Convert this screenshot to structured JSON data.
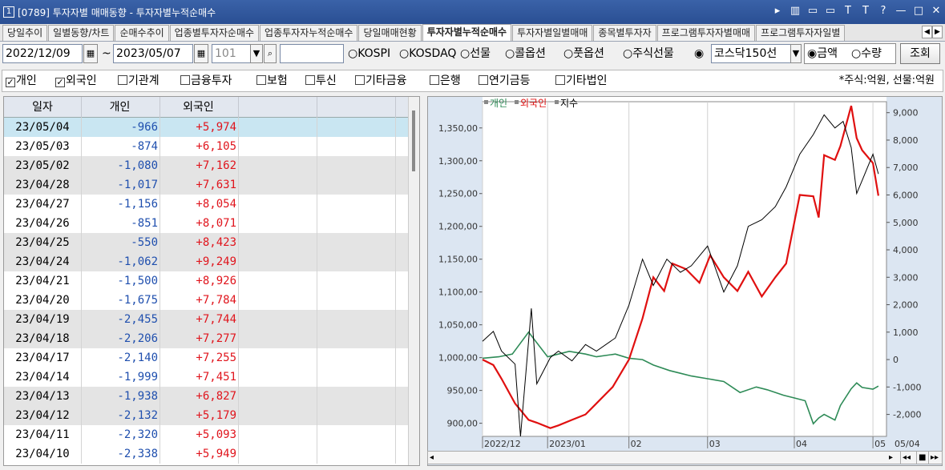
{
  "window": {
    "number": "1",
    "title": "[0789] 투자자별 매매동향 - 투자자별누적순매수",
    "controls": [
      "▸",
      "▥",
      "▭",
      "▭",
      "T",
      "T",
      "?",
      "—",
      "□",
      "✕"
    ]
  },
  "tabs": [
    {
      "label": "당일추이",
      "active": false
    },
    {
      "label": "일별동향/차트",
      "active": false
    },
    {
      "label": "순매수추이",
      "active": false
    },
    {
      "label": "업종별투자자순매수",
      "active": false
    },
    {
      "label": "업종투자자누적순매수",
      "active": false
    },
    {
      "label": "당일매매현황",
      "active": false
    },
    {
      "label": "투자자별누적순매수",
      "active": true
    },
    {
      "label": "투자자별일별매매",
      "active": false
    },
    {
      "label": "종목별투자자",
      "active": false
    },
    {
      "label": "프로그램투자자별매매",
      "active": false
    },
    {
      "label": "프로그램투자자일별",
      "active": false
    }
  ],
  "controls": {
    "start_date": "2022/12/09",
    "tilde": "~",
    "end_date": "2023/05/07",
    "code": "101",
    "code_name": "",
    "market_radios": [
      {
        "label": "KOSPI",
        "checked": false
      },
      {
        "label": "KOSDAQ",
        "checked": false
      },
      {
        "label": "선물",
        "checked": false
      },
      {
        "label": "콜옵션",
        "checked": false
      },
      {
        "label": "풋옵션",
        "checked": false
      },
      {
        "label": "주식선물",
        "checked": false
      },
      {
        "label": "",
        "checked": true
      }
    ],
    "index_select": "코스닥150선",
    "unit_radios": [
      {
        "label": "금액",
        "checked": true
      },
      {
        "label": "수량",
        "checked": false
      }
    ],
    "search_label": "조회"
  },
  "filters": [
    {
      "label": "개인",
      "checked": true
    },
    {
      "label": "외국인",
      "checked": true
    },
    {
      "label": "기관계",
      "checked": false
    },
    {
      "label": "금융투자",
      "checked": false
    },
    {
      "label": "보험",
      "checked": false
    },
    {
      "label": "투신",
      "checked": false
    },
    {
      "label": "기타금융",
      "checked": false
    },
    {
      "label": "은행",
      "checked": false
    },
    {
      "label": "연기금등",
      "checked": false
    },
    {
      "label": "기타법인",
      "checked": false
    }
  ],
  "unit_note": "*주식:억원, 선물:억원",
  "table": {
    "columns": [
      "일자",
      "개인",
      "외국인"
    ],
    "rows": [
      {
        "date": "23/05/04",
        "individual": "-966",
        "foreign": "+5,974"
      },
      {
        "date": "23/05/03",
        "individual": "-874",
        "foreign": "+6,105"
      },
      {
        "date": "23/05/02",
        "individual": "-1,080",
        "foreign": "+7,162"
      },
      {
        "date": "23/04/28",
        "individual": "-1,017",
        "foreign": "+7,631"
      },
      {
        "date": "23/04/27",
        "individual": "-1,156",
        "foreign": "+8,054"
      },
      {
        "date": "23/04/26",
        "individual": "-851",
        "foreign": "+8,071"
      },
      {
        "date": "23/04/25",
        "individual": "-550",
        "foreign": "+8,423"
      },
      {
        "date": "23/04/24",
        "individual": "-1,062",
        "foreign": "+9,249"
      },
      {
        "date": "23/04/21",
        "individual": "-1,500",
        "foreign": "+8,926"
      },
      {
        "date": "23/04/20",
        "individual": "-1,675",
        "foreign": "+7,784"
      },
      {
        "date": "23/04/19",
        "individual": "-2,455",
        "foreign": "+7,744"
      },
      {
        "date": "23/04/18",
        "individual": "-2,206",
        "foreign": "+7,277"
      },
      {
        "date": "23/04/17",
        "individual": "-2,140",
        "foreign": "+7,255"
      },
      {
        "date": "23/04/14",
        "individual": "-1,999",
        "foreign": "+7,451"
      },
      {
        "date": "23/04/13",
        "individual": "-1,938",
        "foreign": "+6,827"
      },
      {
        "date": "23/04/12",
        "individual": "-2,132",
        "foreign": "+5,179"
      },
      {
        "date": "23/04/11",
        "individual": "-2,320",
        "foreign": "+5,093"
      },
      {
        "date": "23/04/10",
        "individual": "-2,338",
        "foreign": "+5,949"
      }
    ]
  },
  "chart_data": {
    "type": "line",
    "legend": [
      "개인",
      "외국인",
      "지수"
    ],
    "colors": {
      "개인": "#2e8b57",
      "외국인": "#e01010",
      "지수": "#000000"
    },
    "left_axis": {
      "ticks": [
        "1,350,00",
        "1,300,00",
        "1,250,00",
        "1,200,00",
        "1,150,00",
        "1,100,00",
        "1,050,00",
        "1,000,00",
        "950,00",
        "900,00"
      ],
      "ylim": [
        880,
        1390
      ]
    },
    "right_axis": {
      "ticks": [
        "9,000",
        "8,000",
        "7,000",
        "6,000",
        "5,000",
        "4,000",
        "3,000",
        "2,000",
        "1,000",
        "0",
        "-1,000",
        "-2,000"
      ],
      "ylim": [
        -2800,
        9400
      ]
    },
    "x_ticks": [
      "2022/12",
      "2023/01",
      "02",
      "03",
      "04",
      "05",
      "05/04"
    ],
    "x_tick_dates": [
      "2022-12-09",
      "2023-01-02",
      "2023-02-01",
      "2023-03-02",
      "2023-04-03",
      "2023-05-02"
    ],
    "x_range": [
      "2022-12-09",
      "2023-05-07"
    ],
    "series": [
      {
        "name": "개인",
        "axis": "right",
        "dates": [
          "2022-12-09",
          "2022-12-15",
          "2022-12-20",
          "2022-12-26",
          "2023-01-02",
          "2023-01-06",
          "2023-01-10",
          "2023-01-16",
          "2023-01-20",
          "2023-01-27",
          "2023-02-01",
          "2023-02-06",
          "2023-02-10",
          "2023-02-16",
          "2023-02-20",
          "2023-02-24",
          "2023-03-02",
          "2023-03-08",
          "2023-03-14",
          "2023-03-20",
          "2023-03-24",
          "2023-03-30",
          "2023-04-03",
          "2023-04-07",
          "2023-04-10",
          "2023-04-12",
          "2023-04-14",
          "2023-04-18",
          "2023-04-20",
          "2023-04-24",
          "2023-04-26",
          "2023-04-28",
          "2023-05-02",
          "2023-05-04"
        ],
        "values": [
          50,
          100,
          200,
          1000,
          100,
          200,
          300,
          200,
          100,
          200,
          50,
          0,
          -200,
          -400,
          -500,
          -600,
          -700,
          -800,
          -1200,
          -1000,
          -1100,
          -1300,
          -1400,
          -1500,
          -2338,
          -2132,
          -1999,
          -2206,
          -1675,
          -1062,
          -851,
          -1017,
          -1080,
          -966
        ]
      },
      {
        "name": "외국인",
        "axis": "right",
        "dates": [
          "2022-12-09",
          "2022-12-13",
          "2022-12-16",
          "2022-12-21",
          "2022-12-26",
          "2022-12-29",
          "2023-01-03",
          "2023-01-06",
          "2023-01-11",
          "2023-01-16",
          "2023-01-19",
          "2023-01-26",
          "2023-02-01",
          "2023-02-06",
          "2023-02-10",
          "2023-02-14",
          "2023-02-17",
          "2023-02-22",
          "2023-02-27",
          "2023-03-03",
          "2023-03-08",
          "2023-03-13",
          "2023-03-17",
          "2023-03-22",
          "2023-03-27",
          "2023-03-31",
          "2023-04-05",
          "2023-04-10",
          "2023-04-12",
          "2023-04-14",
          "2023-04-18",
          "2023-04-20",
          "2023-04-24",
          "2023-04-26",
          "2023-04-28",
          "2023-05-02",
          "2023-05-04"
        ],
        "values": [
          0,
          -200,
          -700,
          -1600,
          -2200,
          -2300,
          -2500,
          -2400,
          -2200,
          -2000,
          -1700,
          -1000,
          0,
          1500,
          3000,
          2500,
          3500,
          3300,
          2800,
          3800,
          3000,
          2500,
          3200,
          2300,
          3000,
          3500,
          6000,
          5949,
          5179,
          7451,
          7277,
          7784,
          9249,
          8071,
          7631,
          7162,
          5974
        ]
      },
      {
        "name": "지수",
        "axis": "left",
        "dates": [
          "2022-12-09",
          "2022-12-13",
          "2022-12-16",
          "2022-12-21",
          "2022-12-23",
          "2022-12-27",
          "2022-12-29",
          "2023-01-03",
          "2023-01-06",
          "2023-01-11",
          "2023-01-16",
          "2023-01-20",
          "2023-01-27",
          "2023-02-01",
          "2023-02-06",
          "2023-02-10",
          "2023-02-15",
          "2023-02-20",
          "2023-02-24",
          "2023-03-02",
          "2023-03-08",
          "2023-03-13",
          "2023-03-17",
          "2023-03-22",
          "2023-03-27",
          "2023-03-31",
          "2023-04-05",
          "2023-04-10",
          "2023-04-14",
          "2023-04-18",
          "2023-04-21",
          "2023-04-24",
          "2023-04-26",
          "2023-04-28",
          "2023-05-02",
          "2023-05-04"
        ],
        "values": [
          1025,
          1040,
          1010,
          990,
          880,
          1075,
          960,
          1000,
          1010,
          995,
          1020,
          1010,
          1030,
          1080,
          1150,
          1110,
          1150,
          1130,
          1140,
          1170,
          1100,
          1140,
          1200,
          1210,
          1230,
          1260,
          1310,
          1340,
          1370,
          1350,
          1360,
          1320,
          1250,
          1270,
          1310,
          1280
        ]
      }
    ]
  },
  "scrollbar_buttons": [
    "◂",
    "▸",
    "◂◂",
    "■",
    "▸▸"
  ]
}
